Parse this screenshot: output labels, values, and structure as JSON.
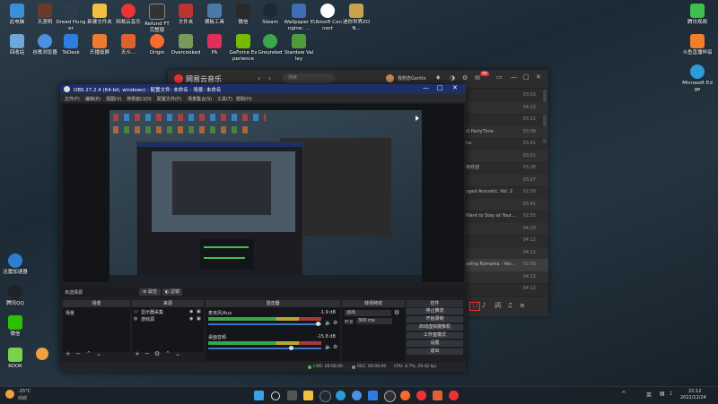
{
  "desktop": {
    "row1": [
      "此电脑",
      "天涯明",
      "Dread Hunger",
      "新建文件夹",
      "网易云音乐",
      "Refund FT 完整版",
      "文件夹",
      "横板工具",
      "微信",
      "Steam",
      "Wallpaper Engine: ...",
      "Ubisoft Connect",
      "迷你世界ZON..."
    ],
    "row2": [
      "回收站",
      "谷歌浏览器",
      "ToDesk",
      "乐播投屏",
      "天斗...",
      "Origin",
      "Overcooked",
      "FA",
      "GeForce Experience",
      "Grounded",
      "Stardew Valley"
    ],
    "left": [
      "迅雷加速器",
      "腾讯QQ",
      "微信",
      "KOOK"
    ],
    "right": [
      "腾讯视频",
      "斗鱼直播伴侣",
      "Microsoft Edge"
    ]
  },
  "music": {
    "title": "网易云音乐",
    "search_placeholder": "搜索",
    "user": "我想念Gentle",
    "badge": "99",
    "rows": [
      {
        "title": "",
        "dur": "03:03"
      },
      {
        "title": "",
        "dur": "04:23"
      },
      {
        "title": "",
        "dur": "03:22"
      },
      {
        "title": "ill PartyTime",
        "dur": "03:08"
      },
      {
        "title": "ha",
        "dur": "03:41"
      },
      {
        "title": "",
        "dur": "03:51"
      },
      {
        "title": "吸欢迎",
        "dur": "03:28"
      },
      {
        "title": "",
        "dur": "03:27"
      },
      {
        "title": "aged Acoustic, Vol. 2",
        "dur": "02:28"
      },
      {
        "title": "",
        "dur": "03:41"
      },
      {
        "title": "Want to Stay at Your...",
        "dur": "02:55"
      },
      {
        "title": "",
        "dur": "04:10"
      },
      {
        "title": "",
        "dur": "04:12"
      },
      {
        "title": "",
        "dur": "04:12"
      },
      {
        "title": "ading Romania - Ver...",
        "dur": "02:58"
      },
      {
        "title": "",
        "dur": "04:12"
      },
      {
        "title": "",
        "dur": "04:12"
      }
    ]
  },
  "obs": {
    "title": "OBS 27.2.4 (64-bit, windows) - 配置文件: 未命名 - 场景: 未命名",
    "menu": [
      "文件(F)",
      "编辑(E)",
      "视图(V)",
      "停靠窗口(D)",
      "配置文件(P)",
      "场景集合(S)",
      "工具(T)",
      "帮助(H)"
    ],
    "no_source": "未选择源",
    "props": "属性",
    "filters": "滤镜",
    "panels": {
      "scenes": "场景",
      "sources": "来源",
      "mixer": "混音器",
      "transitions": "转场特效",
      "controls": "控件"
    },
    "scene_items": [
      "场景"
    ],
    "source_items": [
      "显示器采集",
      "游戏源"
    ],
    "mixer": [
      {
        "name": "桌面音频",
        "db": "-15.8 dB"
      },
      {
        "name": "麦克风/Aux",
        "db": "-1.9 dB"
      }
    ],
    "transition": {
      "type": "淡出",
      "duration_label": "时长",
      "duration": "300 ms"
    },
    "controls": [
      "停止推流",
      "开始录制",
      "启动虚拟摄像机",
      "工作室模式",
      "设置",
      "退出"
    ],
    "status": {
      "live": "LIVE: 00:00:00",
      "rec": "REC: 00:00:00",
      "cpu": "CPU: 4.7%, 29.42 fps"
    }
  },
  "taskbar": {
    "weather_temp": "-15°C",
    "weather_text": "晴朗",
    "lang": "英",
    "time": "22:12",
    "date": "2022/12/24"
  },
  "colors": {
    "obs_title": "#1d2f66",
    "music_red": "#e33",
    "accent_green": "#3fbf4f"
  }
}
